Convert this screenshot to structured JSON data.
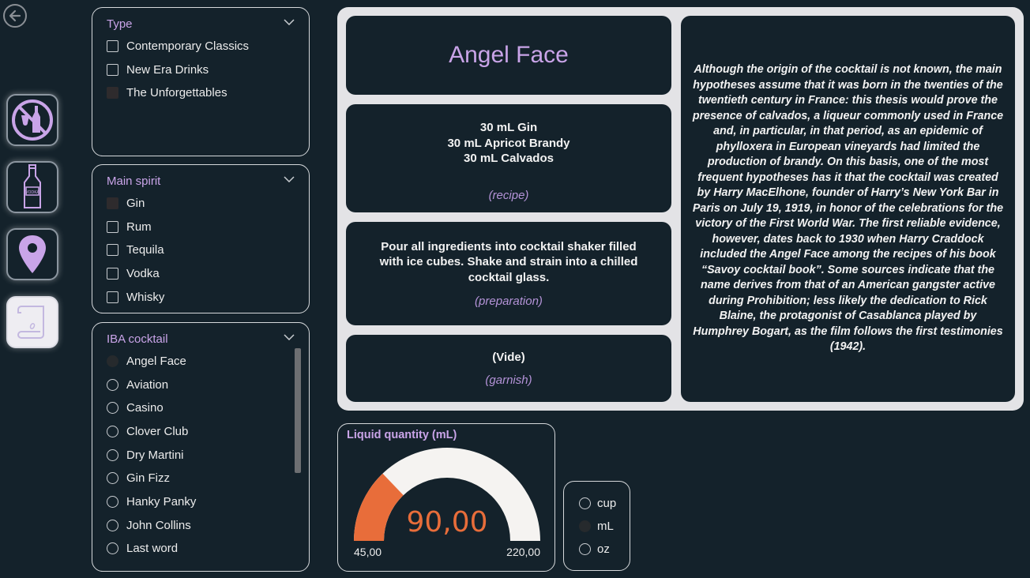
{
  "colors": {
    "background": "#14222b",
    "accent_purple": "#c9a4e8",
    "gauge_fill": "#e86d3a",
    "gauge_track": "#f5f3f1",
    "card_frame": "#e3e3e6"
  },
  "nav": {
    "back_icon": "arrow-left-circle-icon",
    "tiles": [
      {
        "icon": "no-alcohol-icon"
      },
      {
        "icon": "vodka-bottle-icon"
      },
      {
        "icon": "map-pin-icon"
      },
      {
        "icon": "scroll-icon"
      }
    ]
  },
  "filters": {
    "type": {
      "title": "Type",
      "options": [
        "Contemporary Classics",
        "New Era Drinks",
        "The Unforgettables"
      ]
    },
    "main_spirit": {
      "title": "Main spirit",
      "options": [
        "Gin",
        "Rum",
        "Tequila",
        "Vodka",
        "Whisky"
      ]
    },
    "iba_cocktail": {
      "title": "IBA cocktail",
      "options": [
        "Angel Face",
        "Aviation",
        "Casino",
        "Clover Club",
        "Dry Martini",
        "Gin Fizz",
        "Hanky Panky",
        "John Collins",
        "Last word"
      ]
    }
  },
  "cocktail": {
    "name": "Angel Face",
    "recipe_lines": [
      "30 mL Gin",
      "30 mL Apricot Brandy",
      "30 mL Calvados"
    ],
    "recipe_caption": "(recipe)",
    "preparation": "Pour all ingredients into cocktail shaker filled with ice cubes. Shake and strain into a chilled cocktail glass.",
    "preparation_caption": "(preparation)",
    "garnish": "(Vide)",
    "garnish_caption": "(garnish)",
    "story": "Although the origin of the cocktail is not known, the main hypotheses assume that it was born in the twenties of the twentieth century in France: this thesis would prove the presence of calvados, a liqueur commonly used in France and, in particular, in that period, as an epidemic of phylloxera in European vineyards had limited the production of brandy. On this basis, one of the most frequent hypotheses has it that the cocktail was created by Harry MacElhone, founder of Harry’s New York Bar in Paris on July 19, 1919, in honor of the celebrations for the victory of the First World War. The first reliable evidence, however, dates back to 1930 when Harry Craddock included the Angel Face among the recipes of his book “Savoy cocktail book”. Some sources indicate that the name derives from that of an American gangster active during Prohibition; less likely the dedication to Rick Blaine, the protagonist of Casablanca played by Humphrey Bogart, as the film follows the first testimonies (1942)."
  },
  "gauge": {
    "title": "Liquid quantity (mL)",
    "value": 90,
    "value_label": "90,00",
    "min": 45,
    "min_label": "45,00",
    "max": 220,
    "max_label": "220,00"
  },
  "units": {
    "options": [
      "cup",
      "mL",
      "oz"
    ],
    "selected": "mL"
  }
}
